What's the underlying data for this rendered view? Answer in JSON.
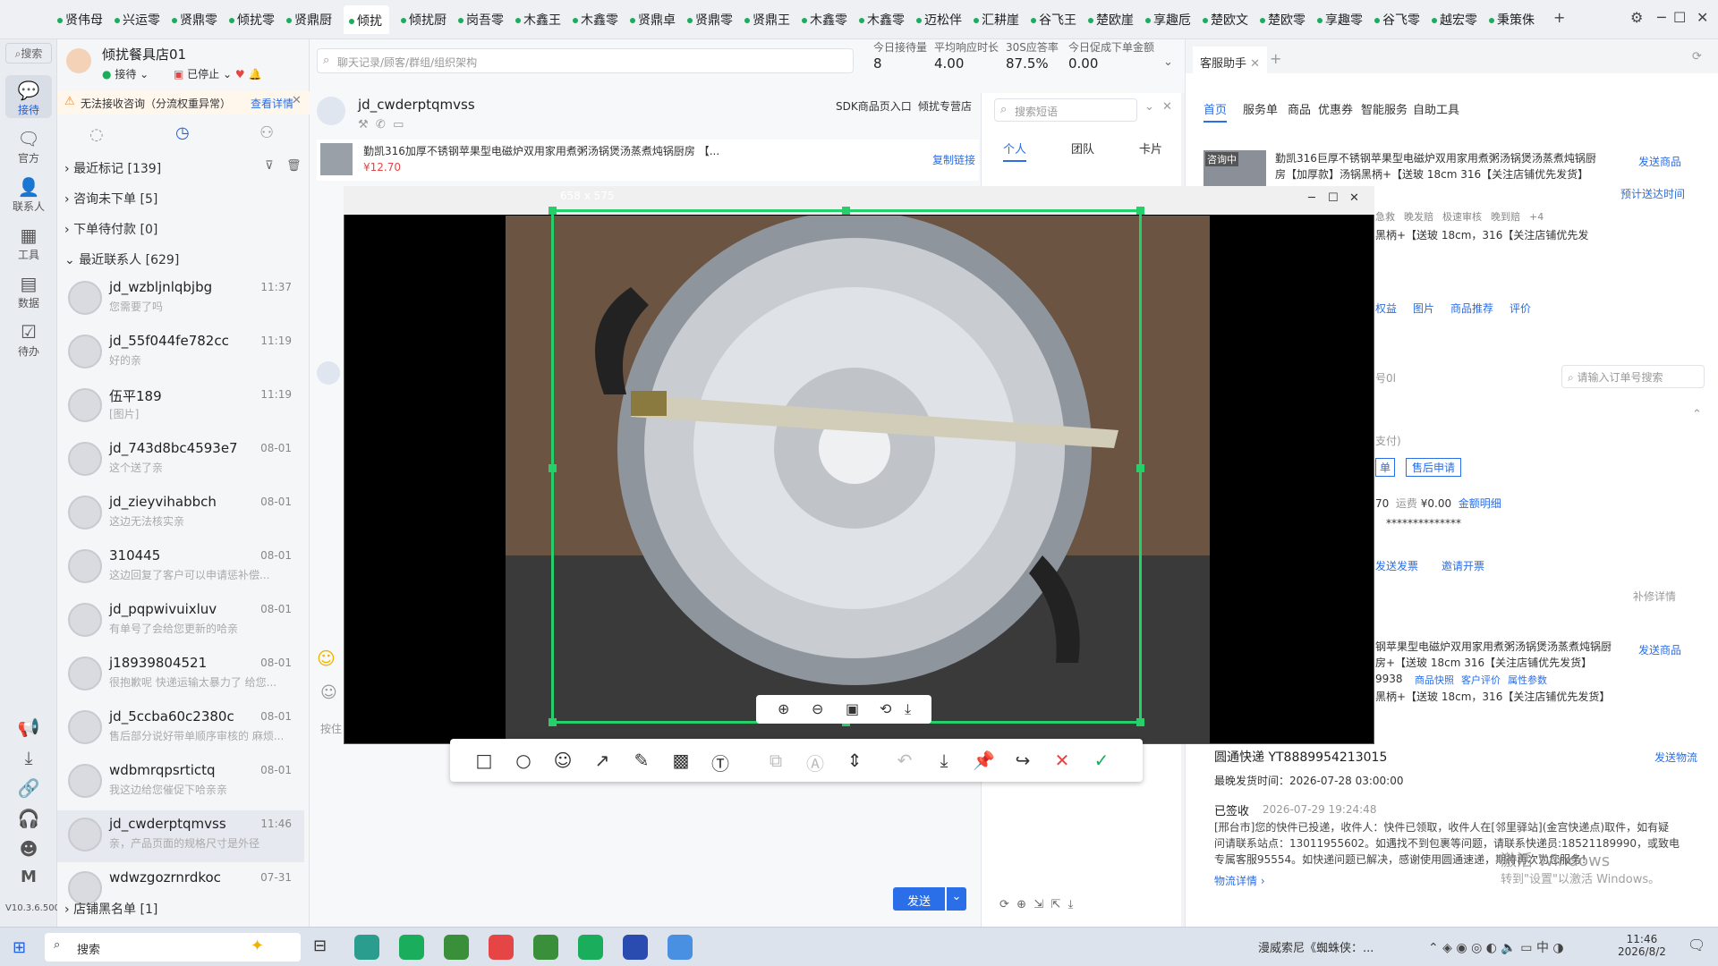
{
  "tabs": [
    "贤伟母",
    "兴运零",
    "贤鼎零",
    "倾扰零",
    "贤鼎厨",
    "倾扰",
    "倾扰厨",
    "岗吾零",
    "木鑫王",
    "木鑫零",
    "贤鼎卓",
    "贤鼎零",
    "贤鼎王",
    "木鑫零",
    "木鑫零",
    "迈松伴",
    "汇耕崖",
    "谷飞王",
    "楚欧崖",
    "享趣卮",
    "楚欧文",
    "楚欧零",
    "享趣零",
    "谷飞零",
    "越宏零",
    "秉策侏"
  ],
  "rail": {
    "search": "搜索",
    "items": [
      "接待",
      "官方",
      "联系人",
      "工具",
      "数据",
      "待办"
    ],
    "version": "V10.3.6.500"
  },
  "store": {
    "name": "倾扰餐具店01",
    "status_receive": "接待",
    "status_stop": "已停止",
    "warning": "无法接收咨询（分流权重异常）",
    "warning_link": "查看详情"
  },
  "sections": {
    "marked": "最近标记 [139]",
    "no_order": "咨询未下单 [5]",
    "unpaid": "下单待付款 [0]",
    "recent": "最近联系人 [629]",
    "blacklist": "店铺黑名单 [1]"
  },
  "contacts": [
    {
      "name": "jd_wzbljnlqbjbg",
      "time": "11:37",
      "preview": "您需要了吗"
    },
    {
      "name": "jd_55f044fe782cc",
      "time": "11:19",
      "preview": "好的亲"
    },
    {
      "name": "伍平189",
      "time": "11:19",
      "preview": "[图片]"
    },
    {
      "name": "jd_743d8bc4593e7",
      "time": "08-01",
      "preview": "这个送了亲"
    },
    {
      "name": "jd_zieyvihabbch",
      "time": "08-01",
      "preview": "这边无法核实亲"
    },
    {
      "name": "310445",
      "time": "08-01",
      "preview": "这边回复了客户可以申请惩补偿..."
    },
    {
      "name": "jd_pqpwivuixluv",
      "time": "08-01",
      "preview": "有单号了会给您更新的哈亲"
    },
    {
      "name": "j18939804521",
      "time": "08-01",
      "preview": "很抱歉呢 快递运输太暴力了 给您..."
    },
    {
      "name": "jd_5ccba60c2380c",
      "time": "08-01",
      "preview": "售后部分说好带单顺序审核的 麻烦..."
    },
    {
      "name": "wdbmrqpsrtictq",
      "time": "08-01",
      "preview": "我这边给您催促下哈亲亲"
    },
    {
      "name": "jd_cwderptqmvss",
      "time": "11:46",
      "preview": "亲，产品页面的规格尺寸是外径"
    },
    {
      "name": "wdwzgozrnrdkoc",
      "time": "07-31",
      "preview": ""
    }
  ],
  "chat": {
    "search_placeholder": "聊天记录/顾客/群组/组织架构",
    "customer": "jd_cwderptqmvss",
    "sdk_entry": "SDK商品页入口",
    "shop": "倾扰专营店",
    "product_title": "勤凯316加厚不锈钢苹果型电磁炉双用家用煮粥汤锅煲汤蒸煮炖锅厨房 【...",
    "product_price": "¥12.70",
    "copy_link": "复制链接",
    "send": "发送",
    "input_hint": "按住"
  },
  "stats": {
    "labels": [
      "今日接待量",
      "平均响应时长",
      "30S应答率",
      "今日促成下单金额"
    ],
    "values": [
      "8",
      "4.00",
      "87.5%",
      "0.00"
    ]
  },
  "phrases": {
    "search_placeholder": "搜索短语",
    "tabs": [
      "个人",
      "团队",
      "卡片"
    ]
  },
  "assistant": {
    "tab": "客服助手",
    "nav": [
      "首页",
      "服务单",
      "商品",
      "优惠券",
      "智能服务",
      "自助工具"
    ],
    "consulting": "咨询中",
    "product1": "勤凯316巨厚不锈钢苹果型电磁炉双用家用煮粥汤锅煲汤蒸煮炖锅厨房【加厚款】汤锅黑柄+【送玻 18cm 316【关注店铺优先发货】",
    "send_product": "发送商品",
    "estimate": "预计送达时间",
    "tags": [
      "急救",
      "晚发赔",
      "极速审核",
      "晚到赔",
      "+4"
    ],
    "spec_line": "黑柄+【送玻 18cm，316【关注店铺优先发",
    "links": [
      "权益",
      "图片",
      "商品推荐",
      "评价"
    ],
    "order_search": "请输入订单号搜索",
    "order_no_label": "号0l",
    "paid": "支付)",
    "aftersale": "售后申请",
    "btn_single": "单",
    "amount_pre": "70",
    "shipping_label": "运费",
    "shipping": "¥0.00",
    "amount_detail": "金额明细",
    "masked": "**************",
    "invoice": "发送发票",
    "invite_invoice": "邀请开票",
    "supplement": "补修详情",
    "product2": "钢苹果型电磁炉双用家用煮粥汤锅煲汤蒸煮炖锅厨房+【送玻 18cm 316【关注店铺优先发货】",
    "product2_code": "9938",
    "p2_links": [
      "商品快照",
      "客户评价",
      "属性参数"
    ],
    "p2_spec": "黑柄+【送玻 18cm，316【关注店铺优先发货】",
    "express": "圆通快递 YT8889954213015",
    "send_logistics": "发送物流",
    "latest_ship_label": "最晚发货时间：",
    "latest_ship": "2026-07-28 03:00:00",
    "signed": "已签收",
    "signed_time": "2026-07-29 19:24:48",
    "logistics_text": "[邢台市]您的快件已投递，收件人：快件已领取，收件人在[邻里驿站](金宫快递点)取件，如有疑问请联系站点：13011955602。如遇找不到包裹等问题，请联系快递员:18521189990，或致电专属客服95554。如快递问题已解决，感谢使用圆通速递，期待再次为您服务！",
    "logistics_link": "物流详情",
    "watermark1": "激活 Windows",
    "watermark2": "转到\"设置\"以激活 Windows。"
  },
  "screenshot": {
    "size": "658 x 575"
  },
  "taskbar": {
    "search": "搜索",
    "music": "漫威索尼《蜘蛛侠：...",
    "time": "11:46",
    "date": "2026/8/2",
    "ime": "中"
  }
}
